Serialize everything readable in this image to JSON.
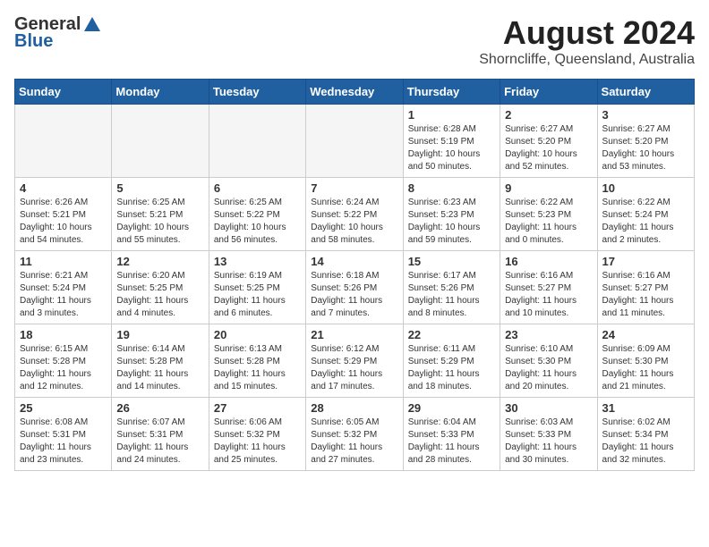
{
  "header": {
    "logo_general": "General",
    "logo_blue": "Blue",
    "month_title": "August 2024",
    "subtitle": "Shorncliffe, Queensland, Australia"
  },
  "days_of_week": [
    "Sunday",
    "Monday",
    "Tuesday",
    "Wednesday",
    "Thursday",
    "Friday",
    "Saturday"
  ],
  "weeks": [
    [
      {
        "day": "",
        "info": ""
      },
      {
        "day": "",
        "info": ""
      },
      {
        "day": "",
        "info": ""
      },
      {
        "day": "",
        "info": ""
      },
      {
        "day": "1",
        "info": "Sunrise: 6:28 AM\nSunset: 5:19 PM\nDaylight: 10 hours\nand 50 minutes."
      },
      {
        "day": "2",
        "info": "Sunrise: 6:27 AM\nSunset: 5:20 PM\nDaylight: 10 hours\nand 52 minutes."
      },
      {
        "day": "3",
        "info": "Sunrise: 6:27 AM\nSunset: 5:20 PM\nDaylight: 10 hours\nand 53 minutes."
      }
    ],
    [
      {
        "day": "4",
        "info": "Sunrise: 6:26 AM\nSunset: 5:21 PM\nDaylight: 10 hours\nand 54 minutes."
      },
      {
        "day": "5",
        "info": "Sunrise: 6:25 AM\nSunset: 5:21 PM\nDaylight: 10 hours\nand 55 minutes."
      },
      {
        "day": "6",
        "info": "Sunrise: 6:25 AM\nSunset: 5:22 PM\nDaylight: 10 hours\nand 56 minutes."
      },
      {
        "day": "7",
        "info": "Sunrise: 6:24 AM\nSunset: 5:22 PM\nDaylight: 10 hours\nand 58 minutes."
      },
      {
        "day": "8",
        "info": "Sunrise: 6:23 AM\nSunset: 5:23 PM\nDaylight: 10 hours\nand 59 minutes."
      },
      {
        "day": "9",
        "info": "Sunrise: 6:22 AM\nSunset: 5:23 PM\nDaylight: 11 hours\nand 0 minutes."
      },
      {
        "day": "10",
        "info": "Sunrise: 6:22 AM\nSunset: 5:24 PM\nDaylight: 11 hours\nand 2 minutes."
      }
    ],
    [
      {
        "day": "11",
        "info": "Sunrise: 6:21 AM\nSunset: 5:24 PM\nDaylight: 11 hours\nand 3 minutes."
      },
      {
        "day": "12",
        "info": "Sunrise: 6:20 AM\nSunset: 5:25 PM\nDaylight: 11 hours\nand 4 minutes."
      },
      {
        "day": "13",
        "info": "Sunrise: 6:19 AM\nSunset: 5:25 PM\nDaylight: 11 hours\nand 6 minutes."
      },
      {
        "day": "14",
        "info": "Sunrise: 6:18 AM\nSunset: 5:26 PM\nDaylight: 11 hours\nand 7 minutes."
      },
      {
        "day": "15",
        "info": "Sunrise: 6:17 AM\nSunset: 5:26 PM\nDaylight: 11 hours\nand 8 minutes."
      },
      {
        "day": "16",
        "info": "Sunrise: 6:16 AM\nSunset: 5:27 PM\nDaylight: 11 hours\nand 10 minutes."
      },
      {
        "day": "17",
        "info": "Sunrise: 6:16 AM\nSunset: 5:27 PM\nDaylight: 11 hours\nand 11 minutes."
      }
    ],
    [
      {
        "day": "18",
        "info": "Sunrise: 6:15 AM\nSunset: 5:28 PM\nDaylight: 11 hours\nand 12 minutes."
      },
      {
        "day": "19",
        "info": "Sunrise: 6:14 AM\nSunset: 5:28 PM\nDaylight: 11 hours\nand 14 minutes."
      },
      {
        "day": "20",
        "info": "Sunrise: 6:13 AM\nSunset: 5:28 PM\nDaylight: 11 hours\nand 15 minutes."
      },
      {
        "day": "21",
        "info": "Sunrise: 6:12 AM\nSunset: 5:29 PM\nDaylight: 11 hours\nand 17 minutes."
      },
      {
        "day": "22",
        "info": "Sunrise: 6:11 AM\nSunset: 5:29 PM\nDaylight: 11 hours\nand 18 minutes."
      },
      {
        "day": "23",
        "info": "Sunrise: 6:10 AM\nSunset: 5:30 PM\nDaylight: 11 hours\nand 20 minutes."
      },
      {
        "day": "24",
        "info": "Sunrise: 6:09 AM\nSunset: 5:30 PM\nDaylight: 11 hours\nand 21 minutes."
      }
    ],
    [
      {
        "day": "25",
        "info": "Sunrise: 6:08 AM\nSunset: 5:31 PM\nDaylight: 11 hours\nand 23 minutes."
      },
      {
        "day": "26",
        "info": "Sunrise: 6:07 AM\nSunset: 5:31 PM\nDaylight: 11 hours\nand 24 minutes."
      },
      {
        "day": "27",
        "info": "Sunrise: 6:06 AM\nSunset: 5:32 PM\nDaylight: 11 hours\nand 25 minutes."
      },
      {
        "day": "28",
        "info": "Sunrise: 6:05 AM\nSunset: 5:32 PM\nDaylight: 11 hours\nand 27 minutes."
      },
      {
        "day": "29",
        "info": "Sunrise: 6:04 AM\nSunset: 5:33 PM\nDaylight: 11 hours\nand 28 minutes."
      },
      {
        "day": "30",
        "info": "Sunrise: 6:03 AM\nSunset: 5:33 PM\nDaylight: 11 hours\nand 30 minutes."
      },
      {
        "day": "31",
        "info": "Sunrise: 6:02 AM\nSunset: 5:34 PM\nDaylight: 11 hours\nand 32 minutes."
      }
    ]
  ]
}
